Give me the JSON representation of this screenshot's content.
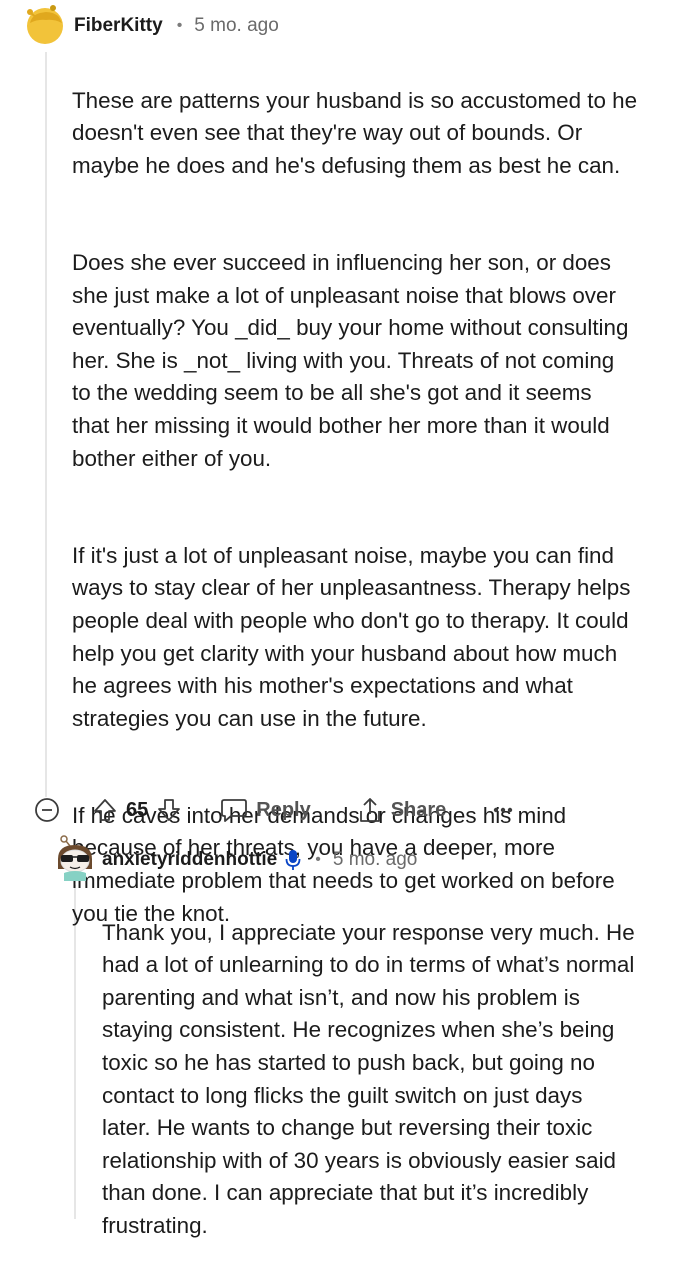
{
  "comment": {
    "username": "FiberKitty",
    "separator": "•",
    "time_ago": "5 mo. ago",
    "paragraphs": [
      "These are patterns your husband is so accustomed to he\ndoesn't even see that they're way out of bounds. Or\nmaybe he does and he's defusing them as best he can.",
      "Does she ever succeed in influencing her son, or does\nshe just make a lot of unpleasant noise that blows over\neventually? You _did_ buy your home without consulting\nher. She is _not_ living with you. Threats of not coming\nto the wedding seem to be all she's got and it seems\nthat her missing it would bother her more than it would\nbother either of you.",
      "If it's just a lot of unpleasant noise, maybe you can find\nways to stay clear of her unpleasantness. Therapy helps\npeople deal with people who don't go to therapy. It could\nhelp you get clarity with your husband about how much\nhe agrees with his mother's expectations and what\nstrategies you can use in the future.",
      "If he caves into her demands or changes his mind\nbecause of her threats, you have a deeper, more\nimmediate problem that needs to get worked on before\nyou tie the knot."
    ],
    "actions": {
      "vote_count": "65",
      "reply_label": "Reply",
      "share_label": "Share"
    },
    "icons": {
      "collapse": "collapse-minus-icon",
      "upvote": "upvote-arrow-icon",
      "downvote": "downvote-arrow-icon",
      "reply": "speech-bubble-icon",
      "share": "share-upload-icon",
      "more": "more-dots-icon"
    }
  },
  "reply": {
    "username": "anxietyriddenhottie",
    "separator": "•",
    "time_ago": "5 mo. ago",
    "paragraphs": [
      "Thank you, I appreciate your response very much. He\nhad a lot of unlearning to do in terms of what’s normal\nparenting and what isn’t, and now his problem is\nstaying consistent. He recognizes when she’s being\ntoxic so he has started to push back, but going no\ncontact to long flicks the guilt switch on just days\nlater. He wants to change but reversing their toxic\nrelationship with of 30 years is obviously easier said\nthan done. I can appreciate that but it’s incredibly\nfrustrating."
    ],
    "icons": {
      "op_badge": "microphone-icon"
    }
  },
  "colors": {
    "avatar_yellow": "#F2C33A",
    "op_badge_blue": "#0A45C6",
    "thread_line": "#E6E6E6",
    "text": "#1C1C1C",
    "meta_text": "#6A6A6A"
  }
}
